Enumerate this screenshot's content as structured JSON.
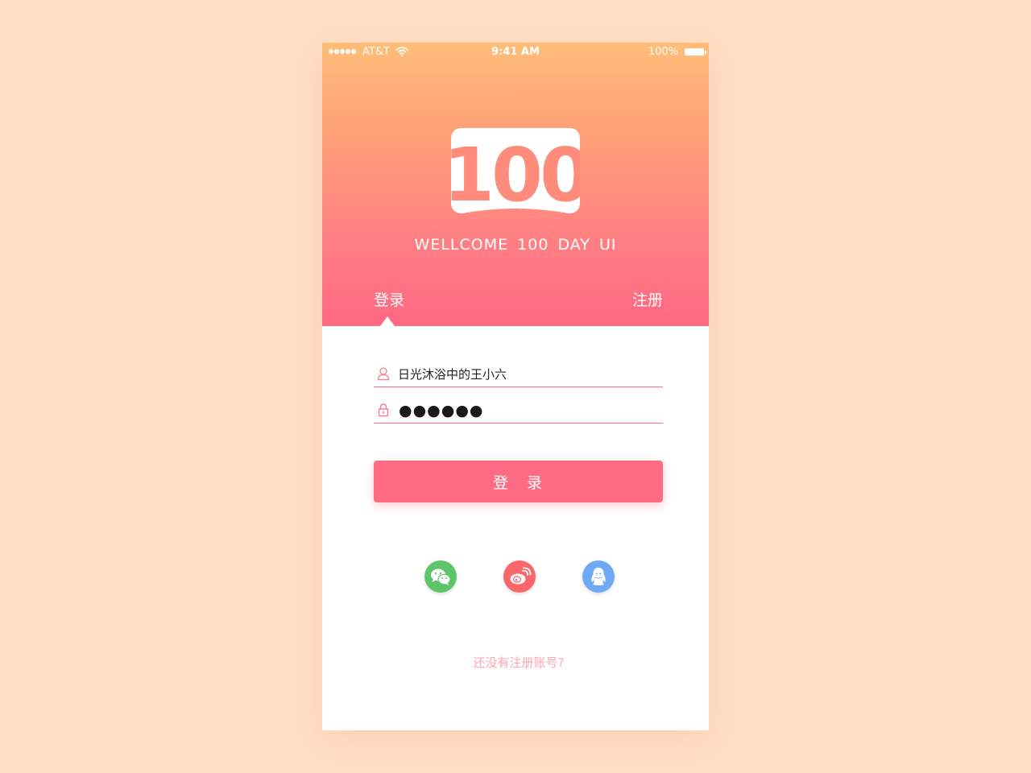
{
  "status_bar": {
    "carrier": "AT&T",
    "time": "9:41 AM",
    "battery": "100%"
  },
  "header": {
    "logo_text": "100",
    "welcome": "WELLCOME 100 DAY UI"
  },
  "tabs": {
    "login": "登录",
    "register": "注册"
  },
  "form": {
    "username_value": "日光沐浴中的王小六",
    "password_mask": "●●●●●●",
    "login_button": "登　录"
  },
  "social": [
    "wechat-icon",
    "weibo-icon",
    "qq-icon"
  ],
  "footer": {
    "register_link": "还没有注册账号?"
  },
  "colors": {
    "accent": "#ff6b83",
    "gradient_top": "#ffbd78",
    "gradient_bottom": "#ff6782",
    "wechat": "#5ec469",
    "weibo": "#f9676a",
    "qq": "#6fa9f6",
    "page_background": "#ffe0c6"
  }
}
